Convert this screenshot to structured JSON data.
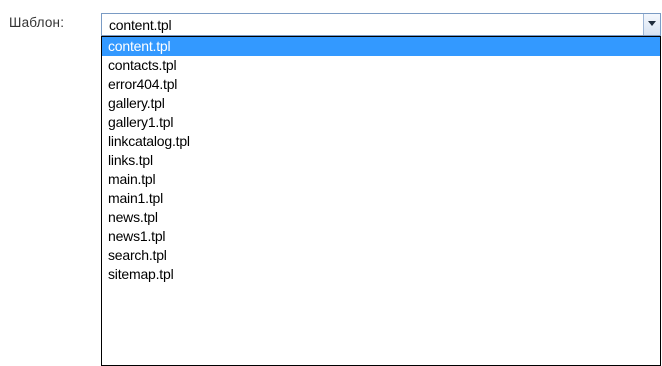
{
  "form": {
    "template_label": "Шаблон:",
    "template_select": {
      "selected_value": "content.tpl",
      "open": true,
      "options": [
        "content.tpl",
        "contacts.tpl",
        "error404.tpl",
        "gallery.tpl",
        "gallery1.tpl",
        "linkcatalog.tpl",
        "links.tpl",
        "main.tpl",
        "main1.tpl",
        "news.tpl",
        "news1.tpl",
        "search.tpl",
        "sitemap.tpl"
      ],
      "highlighted_index": 0,
      "arrow_icon": "dropdown-arrow-icon"
    }
  },
  "colors": {
    "highlight": "#3399ff",
    "highlight_text": "#ffffff",
    "list_border": "#000000",
    "field_border": "#7a9bc4"
  }
}
